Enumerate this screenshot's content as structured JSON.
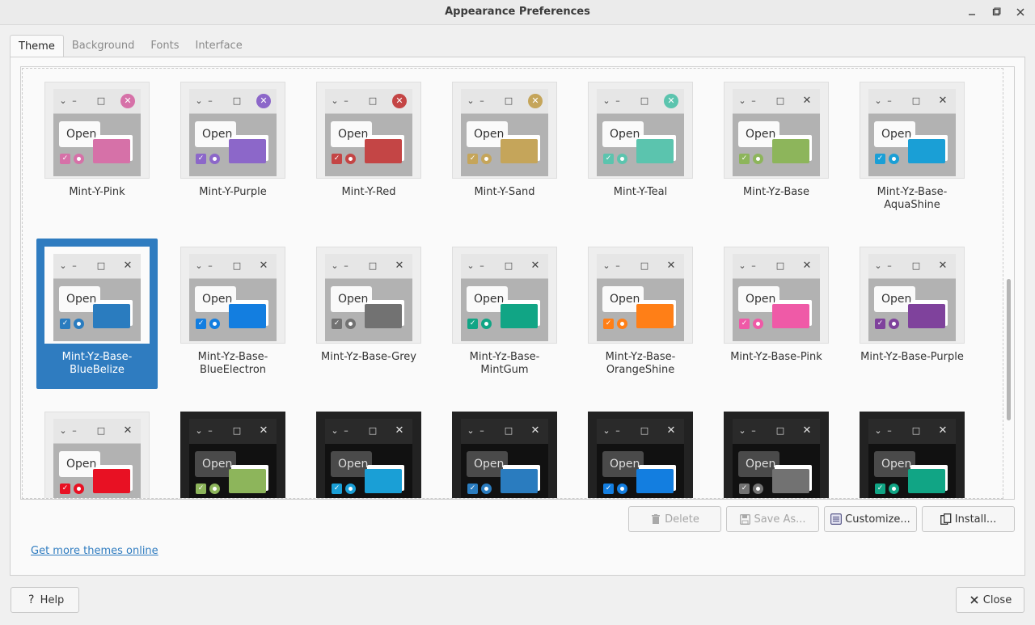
{
  "window": {
    "title": "Appearance Preferences"
  },
  "tabs": [
    {
      "label": "Theme",
      "active": true
    },
    {
      "label": "Background",
      "active": false
    },
    {
      "label": "Fonts",
      "active": false
    },
    {
      "label": "Interface",
      "active": false
    }
  ],
  "preview_labels": {
    "open": "Open"
  },
  "themes": [
    {
      "name": "Mint-Y-Pink",
      "accent": "#d671a8",
      "close_style": "colored",
      "variant": "light"
    },
    {
      "name": "Mint-Y-Purple",
      "accent": "#8c67c9",
      "close_style": "colored",
      "variant": "light"
    },
    {
      "name": "Mint-Y-Red",
      "accent": "#c44545",
      "close_style": "colored",
      "variant": "light"
    },
    {
      "name": "Mint-Y-Sand",
      "accent": "#c5a55a",
      "close_style": "colored",
      "variant": "light"
    },
    {
      "name": "Mint-Y-Teal",
      "accent": "#5bc4ae",
      "close_style": "colored",
      "variant": "light"
    },
    {
      "name": "Mint-Yz-Base",
      "accent": "#8db55b",
      "close_style": "plain",
      "variant": "light"
    },
    {
      "name": "Mint-Yz-Base-AquaShine",
      "accent": "#1a9fd6",
      "close_style": "plain",
      "variant": "light"
    },
    {
      "name": "Mint-Yz-Base-BlueBelize",
      "accent": "#2a7cbf",
      "close_style": "plain",
      "variant": "light",
      "selected": true
    },
    {
      "name": "Mint-Yz-Base-BlueElectron",
      "accent": "#137ee0",
      "close_style": "plain",
      "variant": "light"
    },
    {
      "name": "Mint-Yz-Base-Grey",
      "accent": "#727272",
      "close_style": "plain",
      "variant": "light"
    },
    {
      "name": "Mint-Yz-Base-MintGum",
      "accent": "#11a585",
      "close_style": "plain",
      "variant": "light"
    },
    {
      "name": "Mint-Yz-Base-OrangeShine",
      "accent": "#ff7f17",
      "close_style": "plain",
      "variant": "light"
    },
    {
      "name": "Mint-Yz-Base-Pink",
      "accent": "#ef5aa7",
      "close_style": "plain",
      "variant": "light"
    },
    {
      "name": "Mint-Yz-Base-Purple",
      "accent": "#7f429c",
      "close_style": "plain",
      "variant": "light"
    },
    {
      "name": "",
      "accent": "#e81123",
      "close_style": "plain",
      "variant": "light"
    },
    {
      "name": "",
      "accent": "#8db55b",
      "close_style": "plain",
      "variant": "dark"
    },
    {
      "name": "",
      "accent": "#1a9fd6",
      "close_style": "plain",
      "variant": "dark"
    },
    {
      "name": "",
      "accent": "#2a7cbf",
      "close_style": "plain",
      "variant": "dark"
    },
    {
      "name": "",
      "accent": "#137ee0",
      "close_style": "plain",
      "variant": "dark"
    },
    {
      "name": "",
      "accent": "#727272",
      "close_style": "plain",
      "variant": "dark"
    },
    {
      "name": "",
      "accent": "#11a585",
      "close_style": "plain",
      "variant": "dark"
    }
  ],
  "actions": {
    "delete": "Delete",
    "save_as": "Save As...",
    "customize": "Customize...",
    "install": "Install..."
  },
  "link_text": "Get more themes online",
  "footer": {
    "help": "Help",
    "close": "Close"
  },
  "colors": {
    "selection": "#2f7cc0",
    "link": "#2f7cc0"
  }
}
